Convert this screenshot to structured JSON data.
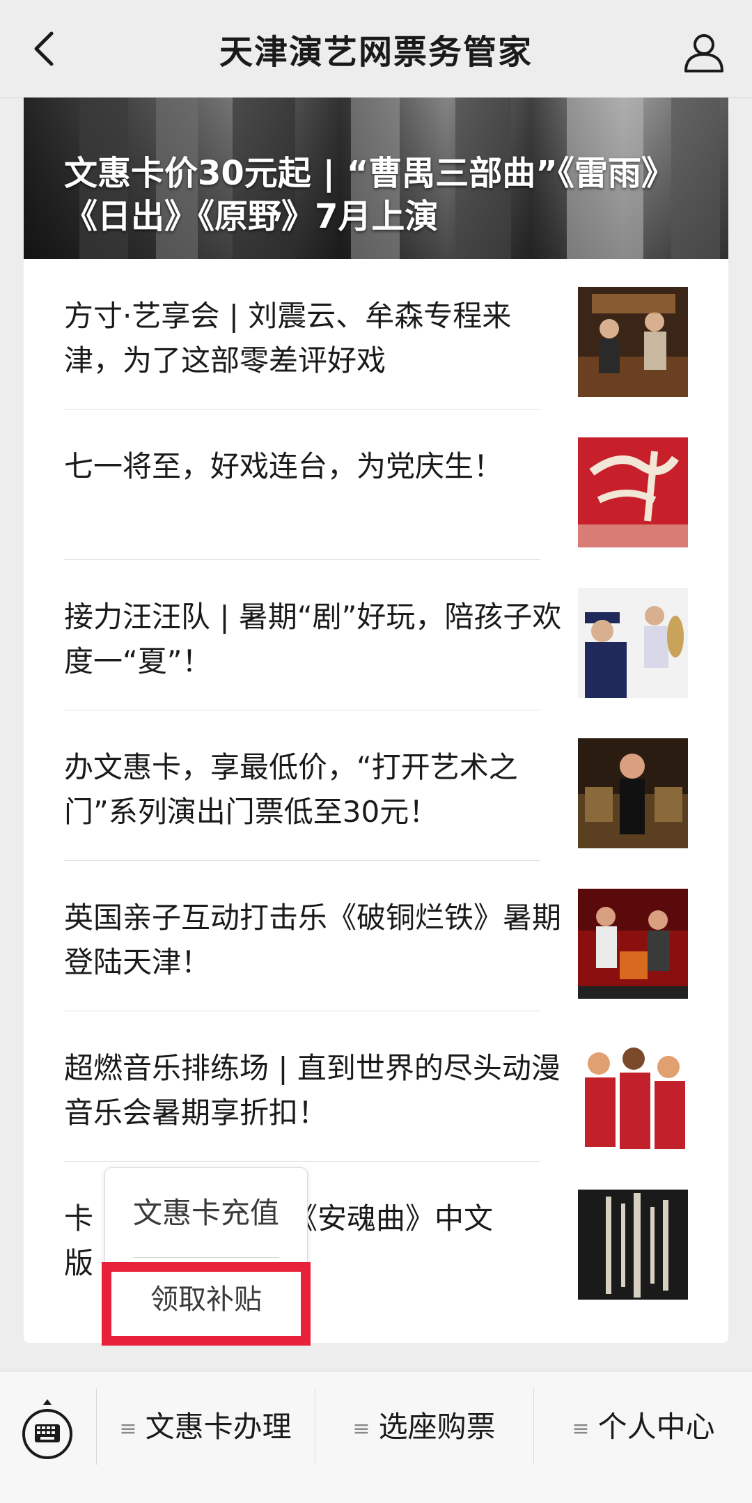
{
  "navbar": {
    "title": "天津演艺网票务管家"
  },
  "hero": {
    "title": "文惠卡价30元起 | “曹禺三部曲”《雷雨》《日出》《原野》7月上演"
  },
  "articles": [
    {
      "title": "方寸·艺享会 | 刘震云、牟森专程来津，为了这部零差评好戏",
      "thumb_colors": [
        "#3b2516",
        "#a9743c"
      ]
    },
    {
      "title": "七一将至，好戏连台，为党庆生！",
      "thumb_colors": [
        "#c8202b",
        "#e8e0d0"
      ]
    },
    {
      "title": "接力汪汪队 | 暑期“剧”好玩，陪孩子欢度一“夏”！",
      "thumb_colors": [
        "#1f2a5a",
        "#c9a35a"
      ]
    },
    {
      "title": "办文惠卡，享最低价，“打开艺术之门”系列演出门票低至30元！",
      "thumb_colors": [
        "#2a1c10",
        "#8a6a3a"
      ]
    },
    {
      "title": "英国亲子互动打击乐《破铜烂铁》暑期登陆天津！",
      "thumb_colors": [
        "#8a1010",
        "#d86a20"
      ]
    },
    {
      "title": "超燃音乐排练场 | 直到世界的尽头动漫音乐会暑期享折扣！",
      "thumb_colors": [
        "#c2202a",
        "#f0d8c0"
      ]
    },
    {
      "title": "卡司《安魂曲》中文版",
      "title_part1": "卡",
      "title_part2": "《安魂曲》中文",
      "title_line2": "版",
      "thumb_colors": [
        "#1a1a1a",
        "#d8d0c0"
      ]
    }
  ],
  "popup": {
    "item1": "文惠卡充值",
    "item2": "领取补贴"
  },
  "bottom_menu": {
    "items": [
      {
        "label": "文惠卡办理"
      },
      {
        "label": "选座购票"
      },
      {
        "label": "个人中心"
      }
    ]
  },
  "colors": {
    "highlight": "#e8203a",
    "background": "#ededed"
  }
}
